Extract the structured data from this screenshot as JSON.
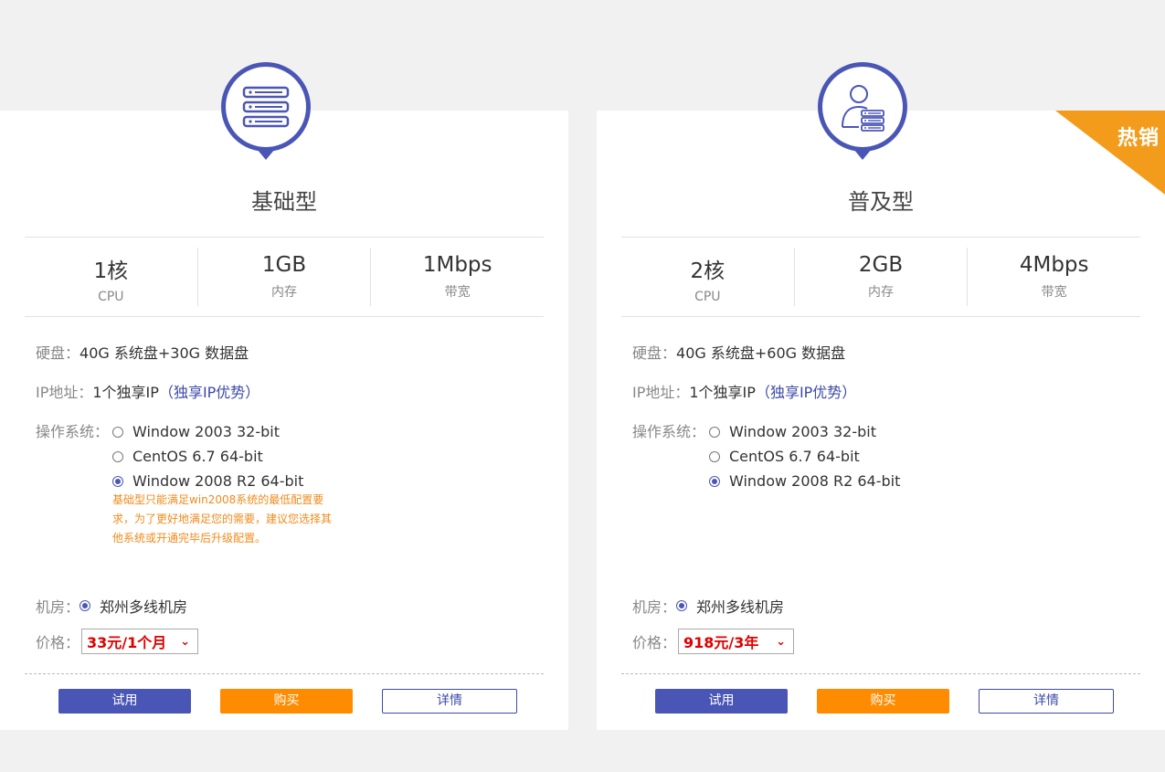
{
  "cards": [
    {
      "title": "基础型",
      "specs": [
        {
          "value": "1核",
          "label": "CPU"
        },
        {
          "value": "1GB",
          "label": "内存"
        },
        {
          "value": "1Mbps",
          "label": "带宽"
        }
      ],
      "disk_label": "硬盘：",
      "disk_value": "40G 系统盘+30G 数据盘",
      "ip_label": "IP地址：",
      "ip_value": "1个独享IP",
      "ip_link": "（独享IP优势）",
      "os_label": "操作系统：",
      "os_options": [
        "Window 2003 32-bit",
        "CentOS 6.7 64-bit",
        "Window 2008 R2 64-bit"
      ],
      "os_selected": 2,
      "notice": "基础型只能满足win2008系统的最低配置要求，为了更好地满足您的需要，建议您选择其他系统或开通完毕后升级配置。",
      "room_label": "机房：",
      "room_value": "郑州多线机房",
      "price_label": "价格：",
      "price_value": "33元/1个月",
      "btn_trial": "试用",
      "btn_buy": "购买",
      "btn_detail": "详情"
    },
    {
      "title": "普及型",
      "badge": "热销",
      "specs": [
        {
          "value": "2核",
          "label": "CPU"
        },
        {
          "value": "2GB",
          "label": "内存"
        },
        {
          "value": "4Mbps",
          "label": "带宽"
        }
      ],
      "disk_label": "硬盘：",
      "disk_value": "40G 系统盘+60G 数据盘",
      "ip_label": "IP地址：",
      "ip_value": "1个独享IP",
      "ip_link": "（独享IP优势）",
      "os_label": "操作系统：",
      "os_options": [
        "Window 2003 32-bit",
        "CentOS 6.7 64-bit",
        "Window 2008 R2 64-bit"
      ],
      "os_selected": 2,
      "room_label": "机房：",
      "room_value": "郑州多线机房",
      "price_label": "价格：",
      "price_value": "918元/3年",
      "btn_trial": "试用",
      "btn_buy": "购买",
      "btn_detail": "详情"
    }
  ],
  "icons": {
    "card0": "server-rack-icon",
    "card1": "user-server-icon",
    "select": "chevron-down-icon"
  },
  "colors": {
    "primary": "#4a56b6",
    "buy": "#ff8c00",
    "badge": "#f39c1c",
    "price": "#e00000",
    "notice": "#f08b1c"
  }
}
